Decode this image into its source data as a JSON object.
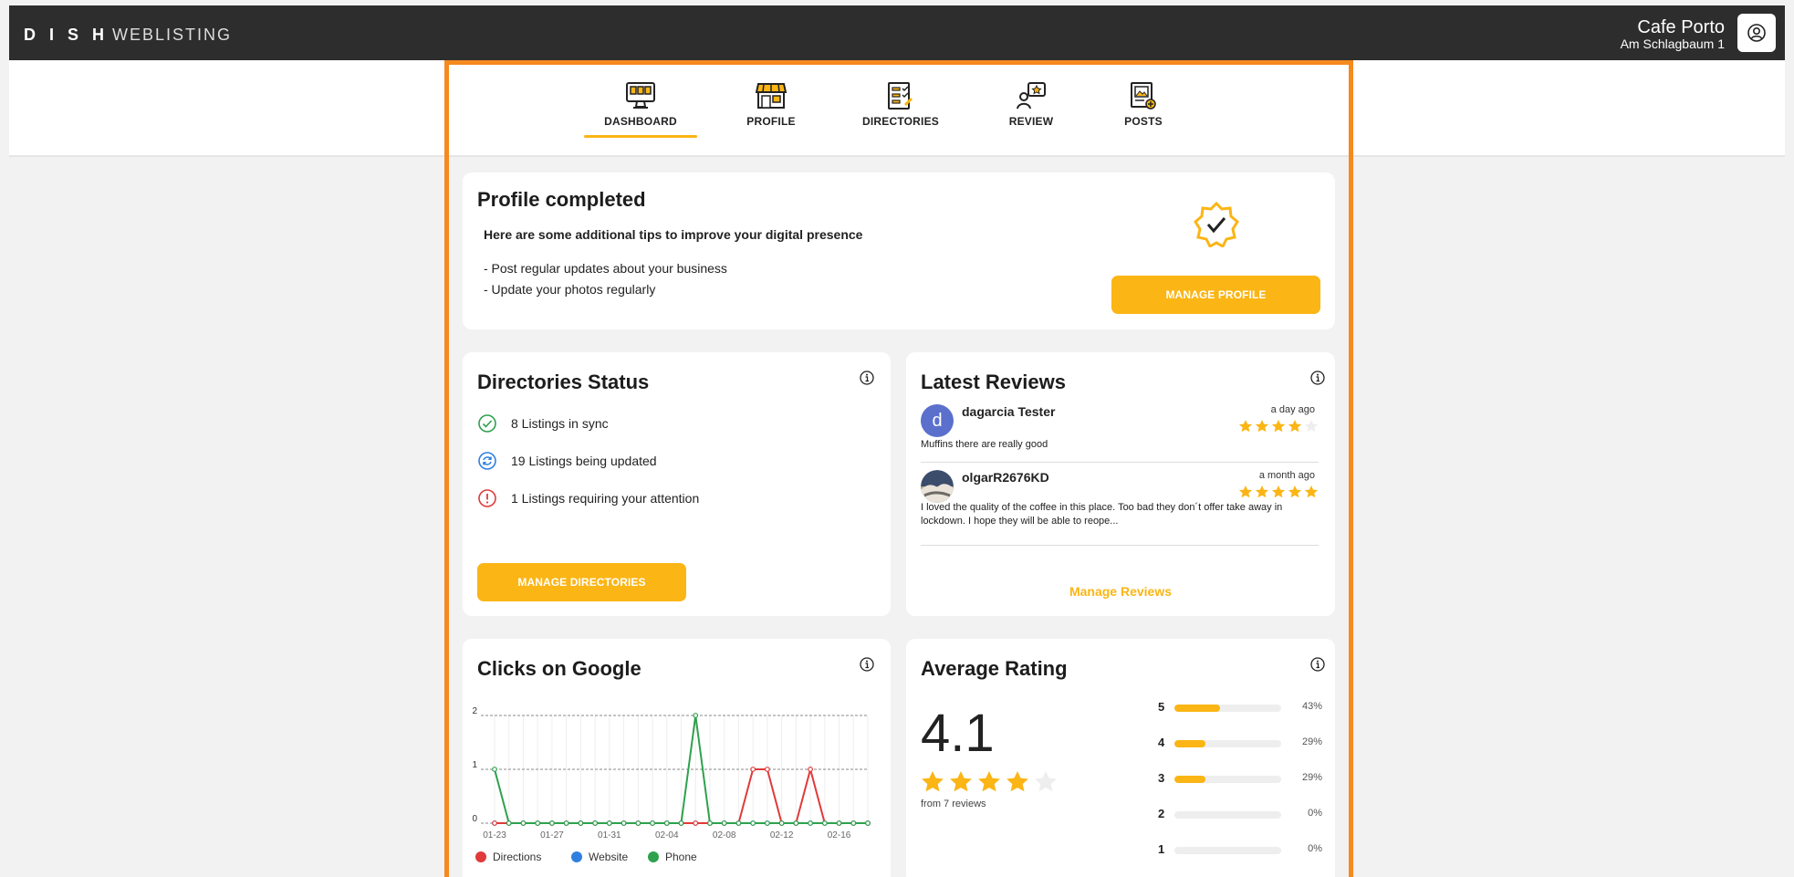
{
  "header": {
    "brand_bold": "D I S H",
    "brand_light": "WEBLISTING",
    "store_name": "Cafe Porto",
    "store_address": "Am Schlagbaum 1"
  },
  "tabs": [
    {
      "label": "DASHBOARD",
      "icon": "monitor-icon",
      "active": true
    },
    {
      "label": "PROFILE",
      "icon": "storefront-icon"
    },
    {
      "label": "DIRECTORIES",
      "icon": "checklist-icon"
    },
    {
      "label": "REVIEW",
      "icon": "review-person-icon"
    },
    {
      "label": "POSTS",
      "icon": "post-image-icon"
    }
  ],
  "profile": {
    "title": "Profile completed",
    "tips_title": "Here are some additional tips to improve your digital presence",
    "tips": [
      "- Post regular updates about your business",
      "- Update your photos regularly"
    ],
    "button": "MANAGE PROFILE"
  },
  "directories": {
    "title": "Directories Status",
    "rows": [
      {
        "text": "8 Listings in sync",
        "status": "ok",
        "color": "#2ea14e"
      },
      {
        "text": "19 Listings being updated",
        "status": "updating",
        "color": "#2f7fe0"
      },
      {
        "text": "1 Listings requiring your attention",
        "status": "error",
        "color": "#e03a3a"
      }
    ],
    "button": "MANAGE DIRECTORIES"
  },
  "reviews": {
    "title": "Latest Reviews",
    "items": [
      {
        "author": "dagarcia Tester",
        "initial": "d",
        "when": "a day ago",
        "rating": 4,
        "text": "Muffins there are really good"
      },
      {
        "author": "olgarR2676KD",
        "initial": "",
        "when": "a month ago",
        "rating": 5,
        "text": "I loved the quality of the coffee in this place. Too bad they don´t offer take away in lockdown. I hope they will be able to reope..."
      }
    ],
    "manage_link": "Manage Reviews"
  },
  "clicks": {
    "title": "Clicks on Google"
  },
  "chart_data": {
    "type": "line",
    "x": [
      "01-23",
      "01-24",
      "01-25",
      "01-26",
      "01-27",
      "01-28",
      "01-29",
      "01-30",
      "01-31",
      "02-01",
      "02-02",
      "02-03",
      "02-04",
      "02-05",
      "02-06",
      "02-07",
      "02-08",
      "02-09",
      "02-10",
      "02-11",
      "02-12",
      "02-13",
      "02-14",
      "02-15",
      "02-16",
      "02-17",
      "02-18"
    ],
    "x_tick_labels": [
      "01-23",
      "01-27",
      "01-31",
      "02-04",
      "02-08",
      "02-12",
      "02-16"
    ],
    "y_ticks": [
      "0",
      "1",
      "2"
    ],
    "ylim": [
      0,
      2
    ],
    "series": [
      {
        "name": "Directions",
        "color": "#e03a3a",
        "values": [
          0,
          0,
          0,
          0,
          0,
          0,
          0,
          0,
          0,
          0,
          0,
          0,
          0,
          0,
          0,
          0,
          0,
          0,
          1,
          1,
          0,
          0,
          1,
          0,
          0,
          0,
          0
        ]
      },
      {
        "name": "Website",
        "color": "#2f7fe0",
        "values": [
          0,
          0,
          0,
          0,
          0,
          0,
          0,
          0,
          0,
          0,
          0,
          0,
          0,
          0,
          0,
          0,
          0,
          0,
          0,
          0,
          0,
          0,
          0,
          0,
          0,
          0,
          0
        ]
      },
      {
        "name": "Phone",
        "color": "#2ea14e",
        "values": [
          1,
          0,
          0,
          0,
          0,
          0,
          0,
          0,
          0,
          0,
          0,
          0,
          0,
          0,
          2,
          0,
          0,
          0,
          0,
          0,
          0,
          0,
          0,
          0,
          0,
          0,
          0
        ]
      }
    ]
  },
  "rating": {
    "title": "Average Rating",
    "value": "4.1",
    "stars": 4,
    "from": "from 7 reviews",
    "distribution": [
      {
        "star": "5",
        "fraction": 0.43,
        "pct": "43%"
      },
      {
        "star": "4",
        "fraction": 0.29,
        "pct": "29%"
      },
      {
        "star": "3",
        "fraction": 0.29,
        "pct": "29%"
      },
      {
        "star": "2",
        "fraction": 0,
        "pct": "0%"
      },
      {
        "star": "1",
        "fraction": 0,
        "pct": "0%"
      }
    ]
  },
  "colors": {
    "accent": "#fbb515",
    "frame": "#f58a1f",
    "topbar": "#2d2d2d"
  }
}
